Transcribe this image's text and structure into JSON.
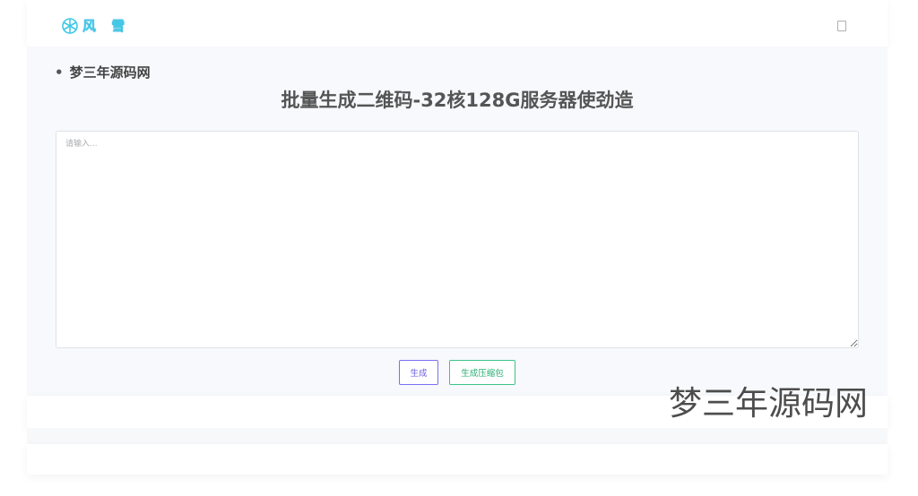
{
  "header": {
    "logo_text": "风 雪",
    "logo_icon": "snowflake-icon",
    "menu_icon": "menu-icon"
  },
  "main": {
    "breadcrumb": "梦三年源码网",
    "title": "批量生成二维码-32核128G服务器使劲造",
    "textarea": {
      "placeholder": "请输入...",
      "value": ""
    },
    "buttons": {
      "generate": "生成",
      "generate_zip": "生成压缩包"
    }
  },
  "watermark": "梦三年源码网",
  "colors": {
    "logo": "#3fc9e6",
    "generate_button": "#7a6ff0",
    "zip_button": "#3cc488",
    "background": "#f7f9fc"
  }
}
